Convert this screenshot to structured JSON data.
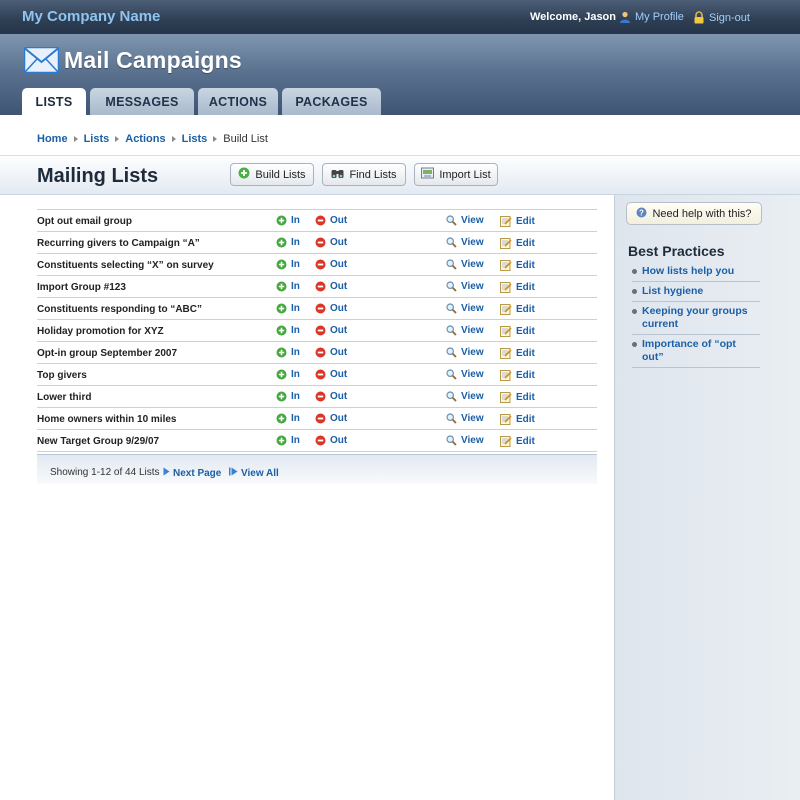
{
  "topbar": {
    "company_name": "My Company Name",
    "welcome": "Welcome, Jason",
    "profile_label": "My Profile",
    "signout_label": "Sign-out"
  },
  "app": {
    "title": "Mail Campaigns"
  },
  "tabs": [
    {
      "label": "LISTS",
      "active": true
    },
    {
      "label": "MESSAGES",
      "active": false
    },
    {
      "label": "ACTIONS",
      "active": false
    },
    {
      "label": "PACKAGES",
      "active": false
    }
  ],
  "breadcrumb": [
    "Home",
    "Lists",
    "Actions",
    "Lists",
    "Build List"
  ],
  "page": {
    "title": "Mailing Lists"
  },
  "toolbar": {
    "build_label": "Build Lists",
    "find_label": "Find Lists",
    "import_label": "Import List"
  },
  "row_actions": {
    "in": "In",
    "out": "Out",
    "view": "View",
    "edit": "Edit"
  },
  "lists": [
    "Opt out email group",
    "Recurring givers to Campaign “A”",
    "Constituents selecting “X” on survey",
    "Import Group #123",
    "Constituents responding to “ABC”",
    "Holiday promotion for XYZ",
    "Opt-in group September 2007",
    "Top givers",
    "Lower third",
    "Home owners within 10 miles",
    "New Target Group 9/29/07"
  ],
  "pagination": {
    "showing": "Showing 1-12 of 44 Lists",
    "next_label": "Next Page",
    "viewall_label": "View All"
  },
  "sidebar": {
    "help_label": "Need help with this?",
    "best_practices_title": "Best Practices",
    "links": [
      "How lists help you",
      "List hygiene",
      "Keeping your groups current",
      "Importance of “opt out”"
    ]
  },
  "colors": {
    "link": "#1b5fa6",
    "header_dark": "#2e3e53",
    "in_green": "#3aa83a",
    "out_red": "#d23a2a"
  }
}
